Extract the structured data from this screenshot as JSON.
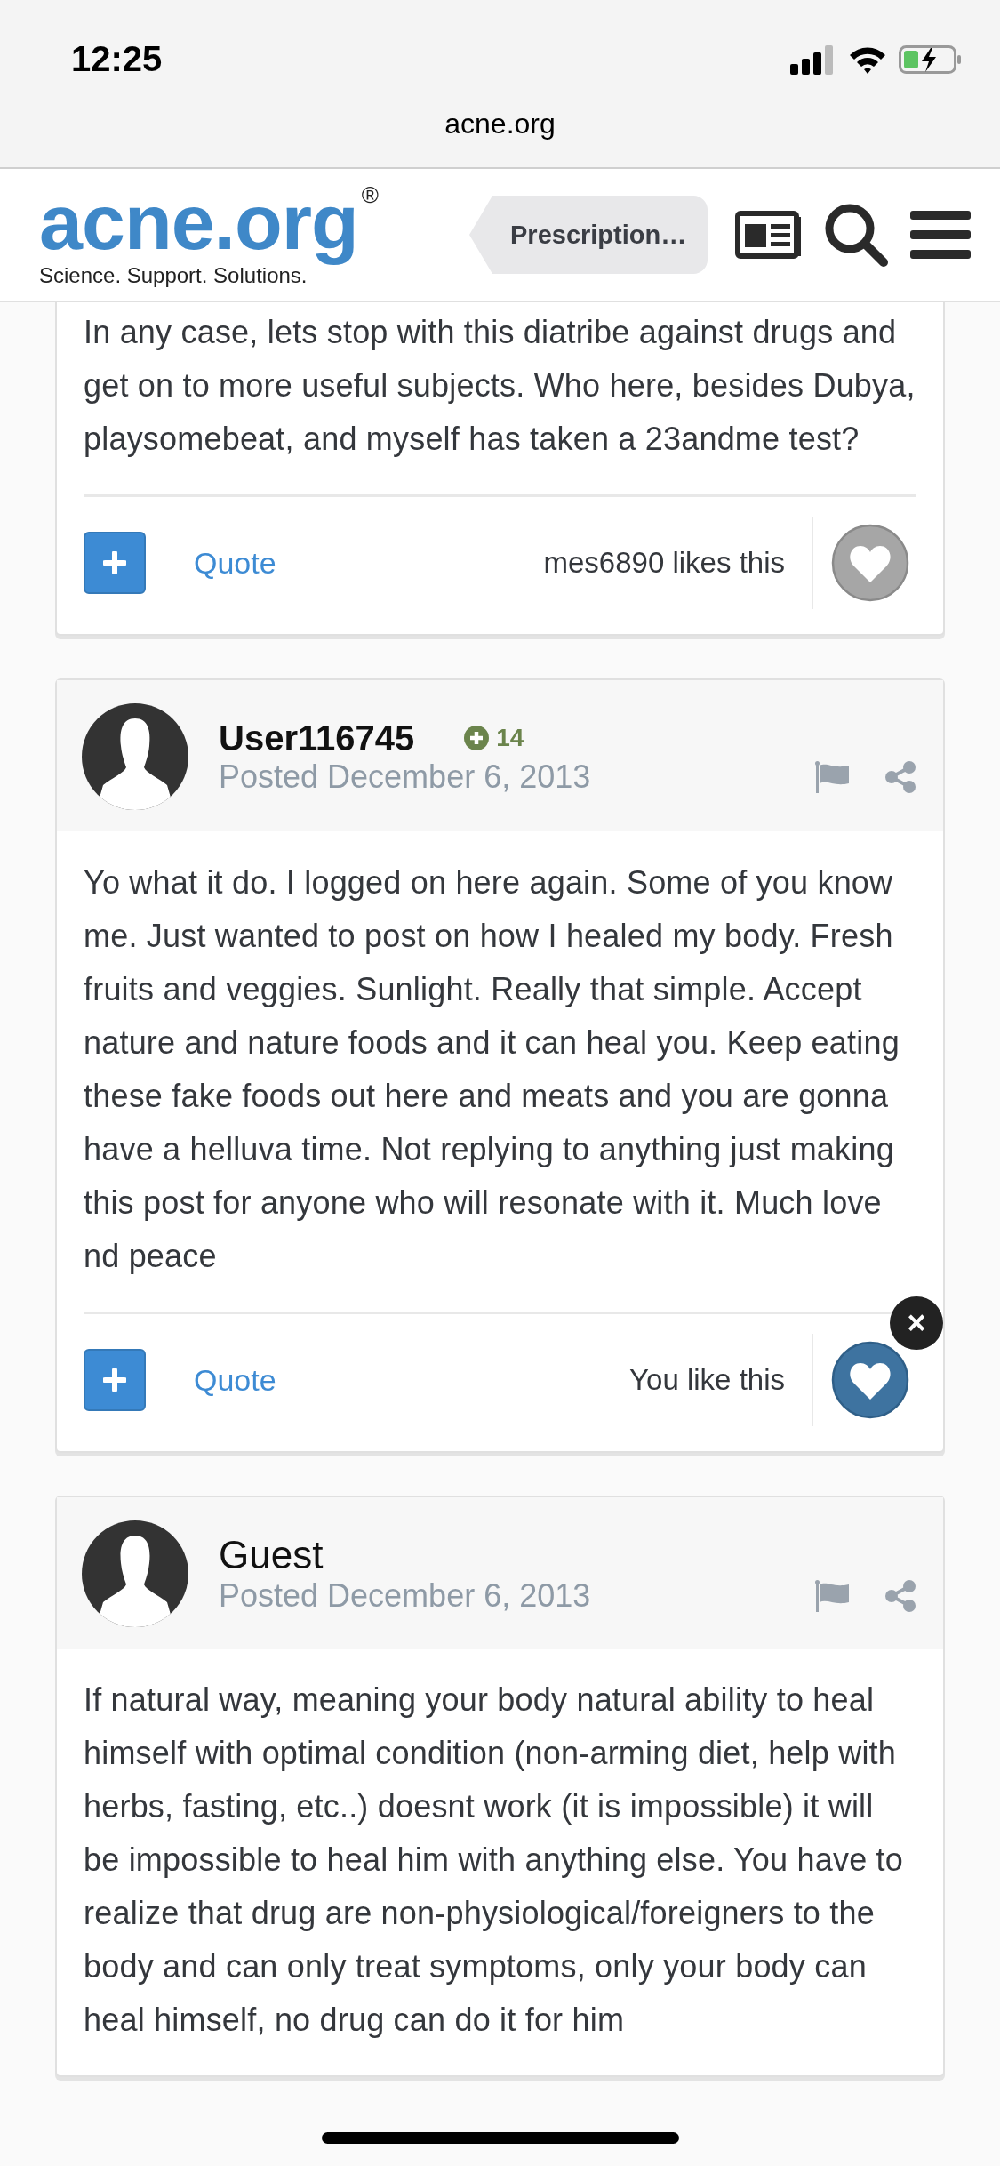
{
  "status_bar": {
    "time": "12:25"
  },
  "browser": {
    "url": "acne.org"
  },
  "header": {
    "logo": "acne.org",
    "registered": "®",
    "tagline": "Science. Support. Solutions.",
    "breadcrumb": "Prescription…"
  },
  "posts": [
    {
      "body": "In any case, lets stop with this diatribe against drugs and get on to more useful subjects. Who here, besides Dubya, playsomebeat, and myself has taken a 23andme test?",
      "footer": {
        "quote": "Quote",
        "likes": "mes6890 likes this",
        "liked": false
      }
    },
    {
      "author": {
        "name": "User116745",
        "bold": true,
        "reputation": "14",
        "posted": "Posted December 6, 2013"
      },
      "body": "Yo what it do. I logged on here again. Some of you know me. Just wanted to post on how I healed my body. Fresh fruits and veggies. Sunlight. Really that simple. Accept nature and nature foods and it can heal you. Keep eating these fake foods out here and meats and you are gonna have a helluva time. Not replying to anything just making this post for anyone who will resonate with it. Much love nd peace",
      "footer": {
        "quote": "Quote",
        "likes": "You like this",
        "liked": true,
        "dismiss": "×"
      }
    },
    {
      "author": {
        "name": "Guest",
        "bold": false,
        "posted": "Posted December 6, 2013"
      },
      "body": "If natural way, meaning your body natural ability to heal himself with optimal condition (non-arming diet, help with herbs, fasting, etc..) doesnt work (it is impossible) it will be impossible to heal him with anything else. You have to realize that drug are non-physiological/foreigners to the body and can only treat symptoms, only your body can heal himself, no drug can do it for him"
    }
  ]
}
